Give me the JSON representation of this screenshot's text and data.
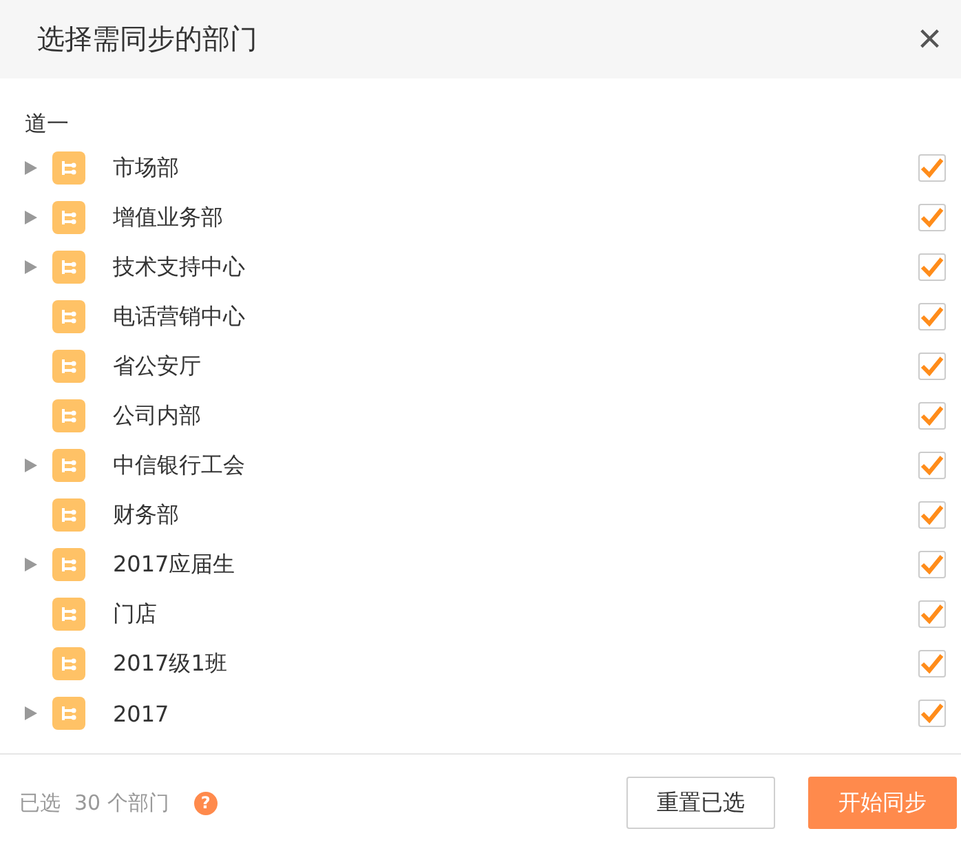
{
  "dialog": {
    "title": "选择需同步的部门",
    "close": "×"
  },
  "root": {
    "label": "道一"
  },
  "departments": [
    {
      "name": "市场部",
      "expandable": true,
      "checked": true
    },
    {
      "name": "增值业务部",
      "expandable": true,
      "checked": true
    },
    {
      "name": "技术支持中心",
      "expandable": true,
      "checked": true
    },
    {
      "name": "电话营销中心",
      "expandable": false,
      "checked": true
    },
    {
      "name": "省公安厅",
      "expandable": false,
      "checked": true
    },
    {
      "name": "公司内部",
      "expandable": false,
      "checked": true
    },
    {
      "name": "中信银行工会",
      "expandable": true,
      "checked": true
    },
    {
      "name": "财务部",
      "expandable": false,
      "checked": true
    },
    {
      "name": "2017应届生",
      "expandable": true,
      "checked": true
    },
    {
      "name": "门店",
      "expandable": false,
      "checked": true
    },
    {
      "name": "2017级1班",
      "expandable": false,
      "checked": true
    },
    {
      "name": "2017",
      "expandable": true,
      "checked": true
    }
  ],
  "footer": {
    "selected_label": "已选",
    "selected_count": "30 个部门",
    "help": "?",
    "buttons": [
      {
        "label": "重置已选",
        "kind": "secondary"
      },
      {
        "label": "开始同步",
        "kind": "primary"
      }
    ]
  }
}
